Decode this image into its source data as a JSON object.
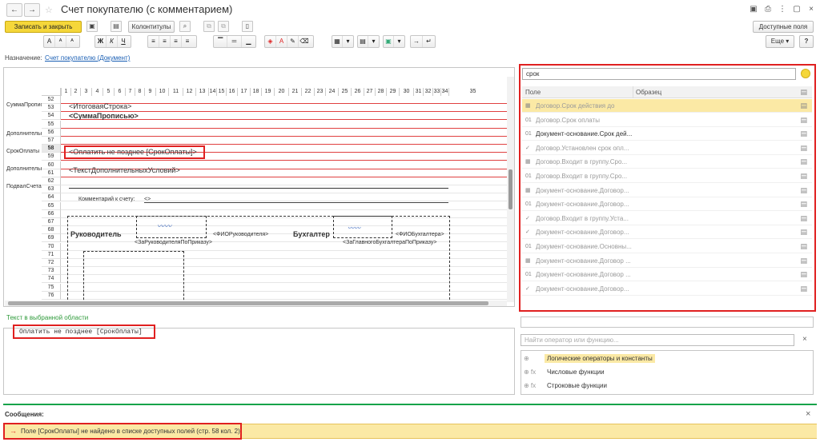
{
  "window": {
    "title": "Счет покупателю (с комментарием)",
    "back": "←",
    "forward": "→"
  },
  "toolbar": {
    "save_close": "Записать и закрыть",
    "headers_footers": "Колонтитулы",
    "available_fields": "Доступные поля",
    "more": "Еще",
    "more_caret": "▾",
    "help": "?"
  },
  "format_bar": {
    "font_group": [
      "A",
      "ᴬ",
      "ᴬ"
    ],
    "style_group": [
      "Ж",
      "К",
      "Ч"
    ],
    "align_group": [
      "≡",
      "≡",
      "≡",
      "≡"
    ],
    "valign_group": [
      "▔",
      "═",
      "▁"
    ]
  },
  "purpose": {
    "label": "Назначение:",
    "value": "Счет покупателю (Документ)"
  },
  "sheet": {
    "columns": [
      "1",
      "2",
      "3",
      "4",
      "5",
      "6",
      "7",
      "8",
      "9",
      "10",
      "11",
      "12",
      "13",
      "14",
      "15",
      "16",
      "17",
      "18",
      "19",
      "20",
      "21",
      "22",
      "23",
      "24",
      "25",
      "26",
      "27",
      "28",
      "29",
      "30",
      "31",
      "32",
      "33",
      "34",
      "35"
    ],
    "rows": [
      "52",
      "53",
      "54",
      "55",
      "56",
      "57",
      "58",
      "59",
      "60",
      "61",
      "62",
      "63",
      "64",
      "65",
      "66",
      "67",
      "68",
      "69",
      "70",
      "71",
      "72",
      "73",
      "74",
      "75",
      "76"
    ],
    "sections": {
      "total_words": "СуммаПрописью",
      "additional1": "Дополнительн",
      "payment_term": "СрокОплаты",
      "additional2": "Дополнительн",
      "footer": "ПодвалСчета"
    },
    "cells": {
      "total_row": "<ИтоговаяСтрока>",
      "total_words": "<СуммаПрописью>",
      "pay_by": "<Оплатить не позднее [СрокОплаты]>",
      "extra_terms": "<ТекстДополнительныхУсловий>",
      "comment_label": "Комментарий к счету:",
      "comment_value": "<>",
      "head_title": "Руководитель",
      "head_name": "<ФИОРуководителя>",
      "head_order": "<ЗаРуководителяПоПриказу>",
      "accountant_title": "Бухгалтер",
      "accountant_name": "<ФИОБухгалтера>",
      "accountant_order": "<ЗаГлавногоБухгалтераПоПриказу>"
    }
  },
  "selection_text": {
    "label": "Текст в выбранной области",
    "value": "Оплатить не позднее [СрокОплаты]"
  },
  "fields_panel": {
    "search_value": "срок",
    "col_field": "Поле",
    "col_sample": "Образец",
    "rows": [
      {
        "icon": "▦",
        "text": "Договор.Срок действия до",
        "selected": true,
        "muted": true
      },
      {
        "icon": "01",
        "text": "Договор.Срок оплаты",
        "selected": false,
        "muted": true
      },
      {
        "icon": "01",
        "text": "Документ-основание.Срок дей...",
        "selected": false,
        "muted": false
      },
      {
        "icon": "✓",
        "text": "Договор.Установлен срок опл...",
        "selected": false,
        "muted": true
      },
      {
        "icon": "▦",
        "text": "Договор.Входит в группу.Сро...",
        "selected": false,
        "muted": true
      },
      {
        "icon": "01",
        "text": "Договор.Входит в группу.Сро...",
        "selected": false,
        "muted": true
      },
      {
        "icon": "▦",
        "text": "Документ-основание.Договор...",
        "selected": false,
        "muted": true
      },
      {
        "icon": "01",
        "text": "Документ-основание.Договор...",
        "selected": false,
        "muted": true
      },
      {
        "icon": "✓",
        "text": "Договор.Входит в группу.Уста...",
        "selected": false,
        "muted": true
      },
      {
        "icon": "✓",
        "text": "Документ-основание.Договор...",
        "selected": false,
        "muted": true
      },
      {
        "icon": "01",
        "text": "Документ-основание.Основны...",
        "selected": false,
        "muted": true
      },
      {
        "icon": "▦",
        "text": "Документ-основание.Договор ...",
        "selected": false,
        "muted": true
      },
      {
        "icon": "01",
        "text": "Документ-основание.Договор ...",
        "selected": false,
        "muted": true
      },
      {
        "icon": "✓",
        "text": "Документ-основание.Договор...",
        "selected": false,
        "muted": true
      }
    ]
  },
  "functions_panel": {
    "search_placeholder": "Найти оператор или функцию...",
    "clear": "×",
    "items": [
      {
        "prefix": "⊕",
        "label": "Логические операторы и константы",
        "selected": true
      },
      {
        "prefix": "⊕ fx",
        "label": "Числовые функции",
        "selected": false
      },
      {
        "prefix": "⊕ fx",
        "label": "Строковые функции",
        "selected": false
      }
    ]
  },
  "messages": {
    "title": "Сообщения:",
    "close": "×",
    "text": "Поле [СрокОплаты] не найдено в списке доступных полей (стр. 58 кол. 2)",
    "arrow": "→"
  },
  "colors": {
    "accent_yellow": "#f5d73a",
    "error_red": "#e02020",
    "link_blue": "#1a5fb4",
    "divider_green": "#16a34a",
    "message_bg": "#fbe9a5"
  }
}
